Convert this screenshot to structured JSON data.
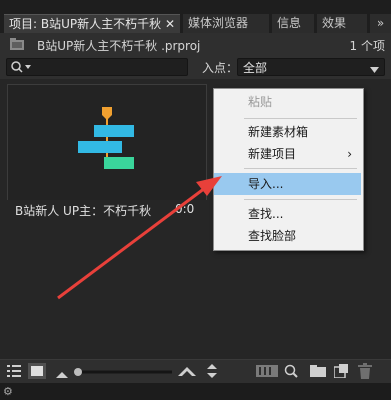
{
  "tabs": {
    "project": "项目: B站UP新人主不朽千秋",
    "media_browser": "媒体浏览器",
    "info": "信息",
    "effects": "效果",
    "more": "»"
  },
  "project_bar": {
    "filename": "B站UP新人主不朽千秋 .prproj",
    "item_count": "1 个项"
  },
  "filter": {
    "inpoint_label": "入点：",
    "inpoint_value": "全部"
  },
  "clip": {
    "name": "B站新人 UP主：不朽千秋",
    "duration": "0:0"
  },
  "context_menu": {
    "paste": "粘贴",
    "new_bin": "新建素材箱",
    "new_item": "新建项目",
    "import": "导入...",
    "find": "查找...",
    "find_face": "查找脸部"
  },
  "colors": {
    "annotation_arrow": "#e8403a",
    "menu_highlight": "#99c9ef",
    "thumb_cyan": "#32b9e4",
    "thumb_green": "#3ad59b",
    "thumb_marker": "#f0a030"
  }
}
